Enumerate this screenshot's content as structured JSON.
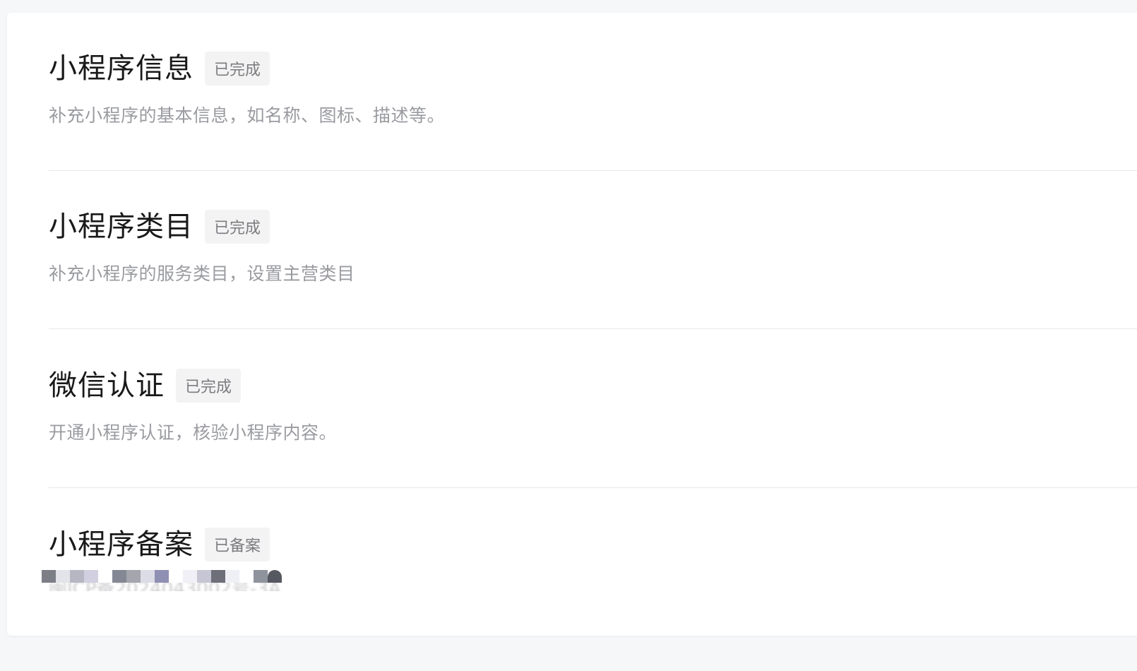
{
  "sections": [
    {
      "title": "小程序信息",
      "status": "已完成",
      "description": "补充小程序的基本信息，如名称、图标、描述等。"
    },
    {
      "title": "小程序类目",
      "status": "已完成",
      "description": "补充小程序的服务类目，设置主营类目"
    },
    {
      "title": "微信认证",
      "status": "已完成",
      "description": "开通小程序认证，核验小程序内容。"
    },
    {
      "title": "小程序备案",
      "status": "已备案",
      "description": "闽ICP备2024043002号-3A"
    }
  ]
}
